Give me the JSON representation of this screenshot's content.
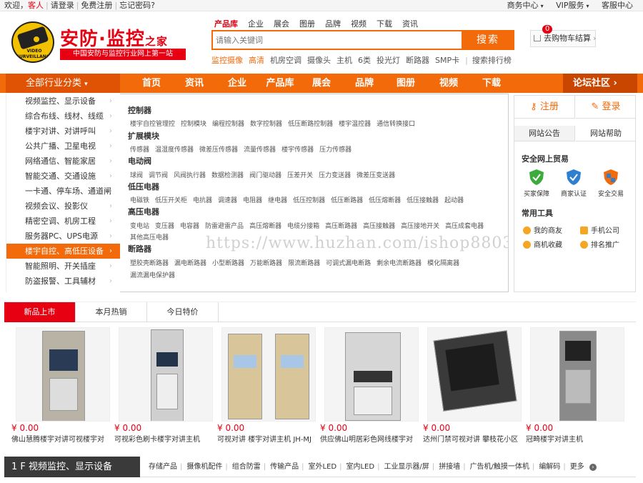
{
  "topbar": {
    "welcome": "欢迎，",
    "guest": "客人",
    "login": "请登录",
    "register": "免费注册",
    "forgot": "忘记密码?",
    "links": [
      "商务中心",
      "VIP服务",
      "客服中心"
    ]
  },
  "logo": {
    "text": "VIDEO SURVEILLANCE"
  },
  "brand": {
    "name": "安防·监控",
    "suffix": "之家",
    "slogan": "中国安防与监控行业网上第一站"
  },
  "search": {
    "tabs": [
      "产品库",
      "企业",
      "展会",
      "图册",
      "品牌",
      "视频",
      "下载",
      "资讯"
    ],
    "placeholder": "请输入关键词",
    "button": "搜索",
    "hot": [
      "监控摄像",
      "高清",
      "机房空调",
      "摄像头",
      "主机",
      "6类",
      "投光灯",
      "断路器",
      "SMP卡"
    ],
    "ranking": "搜索排行榜"
  },
  "cart": {
    "count": "0",
    "label": "去购物车结算"
  },
  "nav": {
    "all_categories": "全部行业分类",
    "items": [
      "首页",
      "资讯",
      "企业",
      "产品库",
      "展会",
      "品牌",
      "图册",
      "视频",
      "下载"
    ],
    "forum": "论坛社区"
  },
  "categories": [
    "视频监控、显示设备",
    "综合布线、线材、线缆",
    "楼宇对讲、对讲呼叫",
    "公共广播、卫星电视",
    "网络通信、智能家居",
    "智能交通、交通设施",
    "一卡通、停车场、通道闸",
    "视频会议、投影仪",
    "精密空调、机房工程",
    "服务器PC、UPS电源",
    "楼宇自控、高低压设备",
    "智能照明、开关插座",
    "防盗报警、工具辅材"
  ],
  "dropdown": {
    "groups": [
      {
        "title": "控制器",
        "items": [
          "楼宇自控管理控",
          "控制模块",
          "编程控制器",
          "数字控制器",
          "低压断路控制器",
          "楼宇温控器",
          "通信转换接口"
        ]
      },
      {
        "title": "扩展模块",
        "items": [
          "传感器",
          "温湿度传感器",
          "微差压传感器",
          "流量传感器",
          "楼宇传感器",
          "压力传感器"
        ]
      },
      {
        "title": "电动阀",
        "items": [
          "球阀",
          "调节阀",
          "风阀执行器",
          "数据检测器",
          "阀门驱动器",
          "压差开关",
          "压力变送器",
          "微差压变送器"
        ]
      },
      {
        "title": "低压电器",
        "items": [
          "电磁铁",
          "低压开关柜",
          "电抗器",
          "调速器",
          "电阻器",
          "继电器",
          "低压控制器",
          "低压断路器",
          "低压熔断器",
          "低压接触器",
          "起动器"
        ]
      },
      {
        "title": "高压电器",
        "items": [
          "变电站",
          "变压器",
          "电容器",
          "防雷避雷产品",
          "高压熔断器",
          "电缆分接箱",
          "高压断路器",
          "高压接触器",
          "高压接地开关",
          "高压成套电器",
          "其他高压电器"
        ]
      },
      {
        "title": "断路器",
        "items": [
          "塑胶壳断路器",
          "漏电断路器",
          "小型断路器",
          "万能断路器",
          "限流断路器",
          "可调式漏电断路",
          "剩余电流断路器",
          "模化隔离器",
          "漏流漏电保护器"
        ]
      }
    ],
    "watermark": "https://www.huzhan.com/ishop8803"
  },
  "account": {
    "register": "注册",
    "login": "登录"
  },
  "notice_tabs": [
    "网站公告",
    "网站帮助"
  ],
  "secure": {
    "title": "安全网上贸易",
    "items": [
      "买家保障",
      "商家认证",
      "安全交易"
    ]
  },
  "tools": {
    "title": "常用工具",
    "items": [
      "我的商友",
      "手机公司",
      "商机收藏",
      "排名推广"
    ]
  },
  "product_tabs": [
    "新品上市",
    "本月热销",
    "今日特价"
  ],
  "products": [
    {
      "price": "¥ 0.00",
      "name": "佛山慧腾楼宇对讲可视楼宇对"
    },
    {
      "price": "¥ 0.00",
      "name": "可视彩色刷卡楼宇对讲主机"
    },
    {
      "price": "¥ 0.00",
      "name": "可视对讲 楼宇对讲主机 JH-MJ"
    },
    {
      "price": "¥ 0.00",
      "name": "供应佛山明居彩色网线楼宇对"
    },
    {
      "price": "¥ 0.00",
      "name": "达州门禁可视对讲 攀枝花小区"
    },
    {
      "price": "¥ 0.00",
      "name": "冠畸楼宇对讲主机"
    }
  ],
  "floor": {
    "label": "1 F  视频监控、显示设备",
    "links": [
      "存储产品",
      "摄像机配件",
      "组合防雷",
      "传输产品",
      "室外LED",
      "室内LED",
      "工业显示器/屏",
      "拼接墙",
      "广告机/触摸一体机",
      "编解码"
    ],
    "more": "更多"
  },
  "colors": {
    "brand_red": "#e60012",
    "accent_orange": "#f36a0b"
  }
}
